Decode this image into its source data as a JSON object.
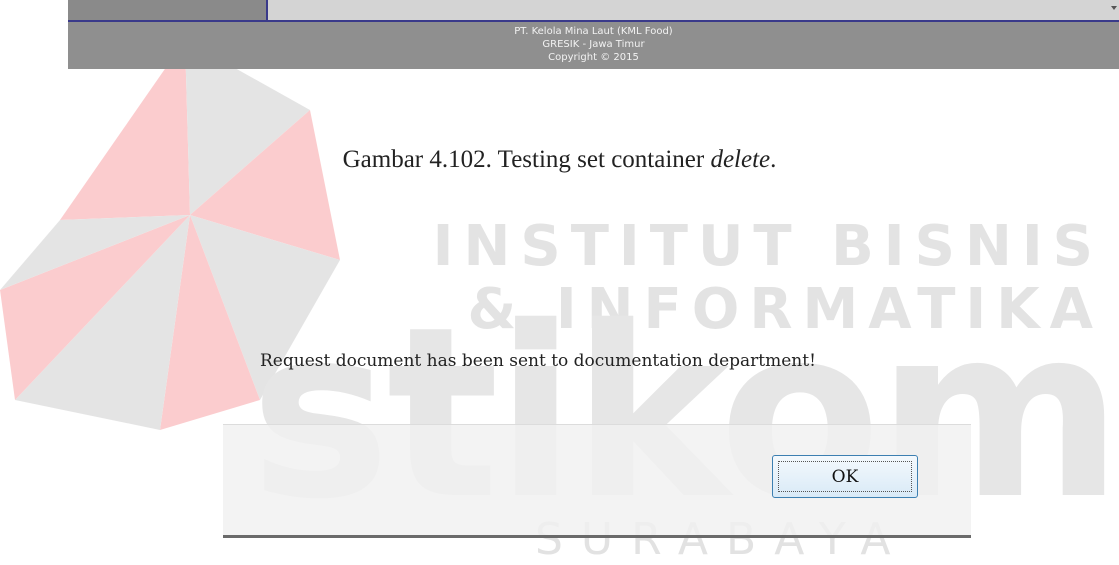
{
  "top_strip": {
    "footer_lines": [
      "PT. Kelola Mina Laut (KML Food)",
      "GRESIK - Jawa Timur",
      "Copyright © 2015"
    ]
  },
  "caption": {
    "prefix": "Gambar 4.102. Testing set container ",
    "emphasis": "delete",
    "suffix": "."
  },
  "dialog": {
    "message": "Request document has been sent to documentation department!",
    "ok_label": "OK"
  },
  "watermark": {
    "line1": "INSTITUT BISNIS",
    "line2": "& INFORMATIKA",
    "wordmark": "stikom",
    "city": "SURABAYA",
    "logo_color": "#ee1c25"
  }
}
